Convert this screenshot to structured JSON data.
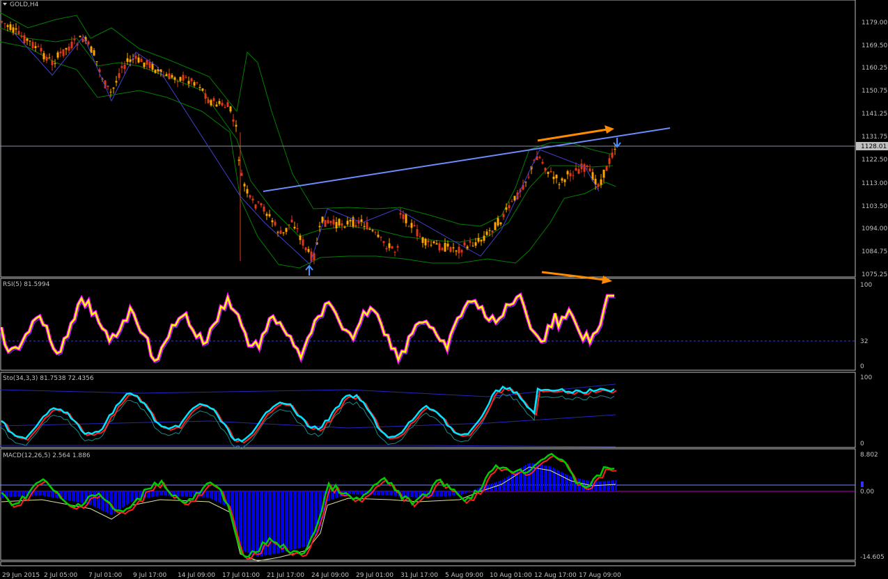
{
  "window": {
    "title": "GOLD,H4",
    "symbol": "GOLD",
    "timeframe": "H4",
    "current_price_label": "1128.01"
  },
  "price_panel": {
    "axis_labels": [
      "1179.00",
      "1169.50",
      "1160.25",
      "1150.75",
      "1141.25",
      "1131.75",
      "1122.50",
      "1113.00",
      "1103.50",
      "1094.00",
      "1084.75",
      "1075.25"
    ],
    "axis_values": [
      1179.0,
      1169.5,
      1160.25,
      1150.75,
      1141.25,
      1131.75,
      1122.5,
      1113.0,
      1103.5,
      1094.0,
      1084.75,
      1075.25
    ],
    "range": [
      1073.0,
      1188.0
    ]
  },
  "rsi_panel": {
    "title": "RSI(5) 81.5994",
    "axis_labels": [
      "100",
      "32",
      "0"
    ],
    "axis_values": [
      100,
      32,
      0
    ]
  },
  "stoch_panel": {
    "title": "Sto(34,3,3) 81.7538 72.4356",
    "axis_labels": [
      "100",
      "0"
    ],
    "axis_values": [
      100,
      0
    ]
  },
  "macd_panel": {
    "title": "MACD(12,26,5) 2.564 1.886",
    "axis_labels": [
      "8.802",
      "0.00",
      "-14.605"
    ],
    "axis_values": [
      8.802,
      0.0,
      -14.605
    ]
  },
  "time_axis": {
    "labels": [
      "29 Jun 2015",
      "2 Jul 05:00",
      "7 Jul 01:00",
      "9 Jul 17:00",
      "14 Jul 09:00",
      "17 Jul 01:00",
      "21 Jul 17:00",
      "24 Jul 09:00",
      "29 Jul 01:00",
      "31 Jul 17:00",
      "5 Aug 09:00",
      "10 Aug 01:00",
      "12 Aug 17:00",
      "17 Aug 09:00"
    ]
  },
  "colors": {
    "background": "#000000",
    "bull_candle": "#ffa500",
    "bear_candle": "#e0371d",
    "bands": "#008000",
    "trendline": "#6b8cff",
    "arrow": "#ff8c00",
    "rsi_main": "#ffff00",
    "rsi_glow": "#ff00ff",
    "stoch_main": "#00e5ff",
    "stoch_signal": "#ff2020",
    "macd_hist": "#0000ff",
    "macd_fast": "#00cc00",
    "macd_slow": "#ff2020"
  }
}
